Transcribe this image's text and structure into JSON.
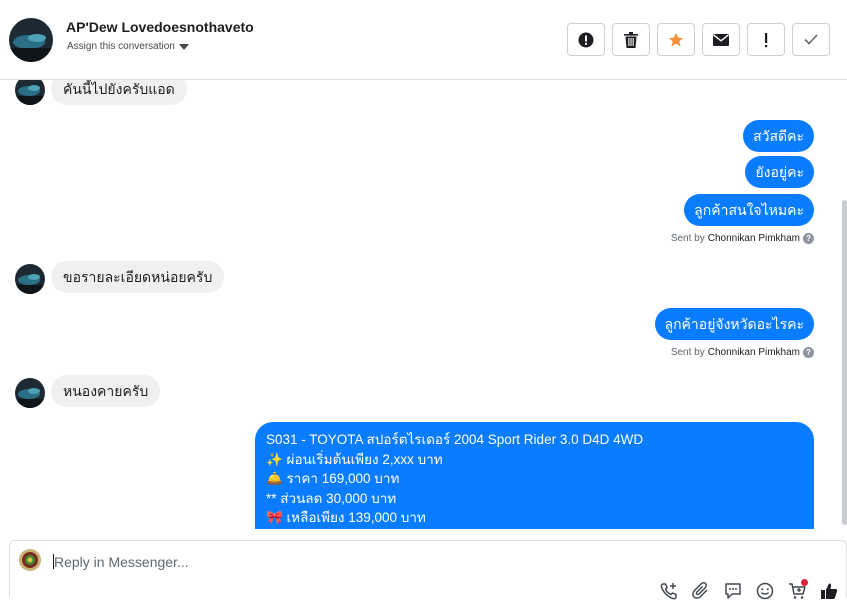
{
  "header": {
    "name": "AP'Dew Lovedoesnothaveto",
    "assign_label": "Assign this conversation",
    "actions": [
      {
        "icon": "alert-circle-icon",
        "label": "spam"
      },
      {
        "icon": "trash-icon",
        "label": "delete"
      },
      {
        "icon": "star-icon",
        "label": "star"
      },
      {
        "icon": "envelope-icon",
        "label": "mark unread"
      },
      {
        "icon": "exclamation-icon",
        "label": "follow up"
      },
      {
        "icon": "checkmark-icon",
        "label": "done"
      }
    ]
  },
  "messages": {
    "in1": "คันนี้ไปยังครับแอด",
    "out1": "สวัสดีคะ",
    "out2": "ยังอยู่คะ",
    "out3": "ลูกค้าสนใจไหมคะ",
    "in2": "ขอรายละเอียดหน่อยครับ",
    "out4": "ลูกค้าอยู่จังหวัดอะไรคะ",
    "in3": "หนองคายครับ",
    "listing": [
      "S031 - TOYOTA สปอร์ตไรเดอร์ 2004 Sport Rider 3.0 D4D 4WD",
      "✨ ผ่อนเริ่มต้นเพียง 2,xxx บาท",
      "🛎️ ราคา 169,000 บาท",
      "** ส่วนลด 30,000 บาท",
      "🎀 เหลือเพียง 139,000 บาท"
    ]
  },
  "sent_by": {
    "prefix": "Sent by",
    "agent": "Chonnikan Pimkham",
    "help": "?"
  },
  "composer": {
    "placeholder": "Reply in Messenger...",
    "tools": [
      "add-call-icon",
      "attachment-icon",
      "saved-reply-icon",
      "emoji-icon",
      "cart-icon",
      "like-icon"
    ]
  },
  "colors": {
    "brand_blue": "#0a7cff",
    "incoming_gray": "#f1f0f0",
    "star_orange": "#f7923b"
  }
}
